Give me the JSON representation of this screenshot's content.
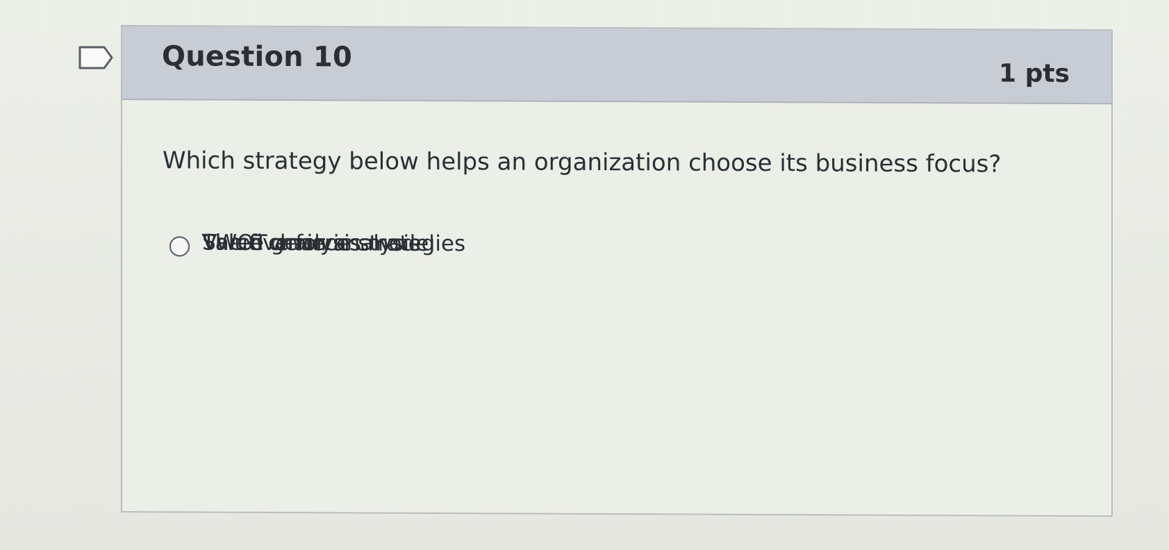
{
  "question": {
    "title": "Question 10",
    "points": "1 pts",
    "prompt": "Which strategy below helps an organization choose its business focus?",
    "flag_icon": "bookmark-flag-icon"
  },
  "answers": [
    {
      "label": "Three generic strategies",
      "selected": false
    },
    {
      "label": "Value chain analysis",
      "selected": true
    },
    {
      "label": "SWOT analysis",
      "selected": false
    },
    {
      "label": "The five forces model",
      "selected": false
    }
  ],
  "colors": {
    "header_background": "#c8ccd4",
    "selected_radio": "#1a56b2",
    "page_background": "#e9ebe4"
  }
}
